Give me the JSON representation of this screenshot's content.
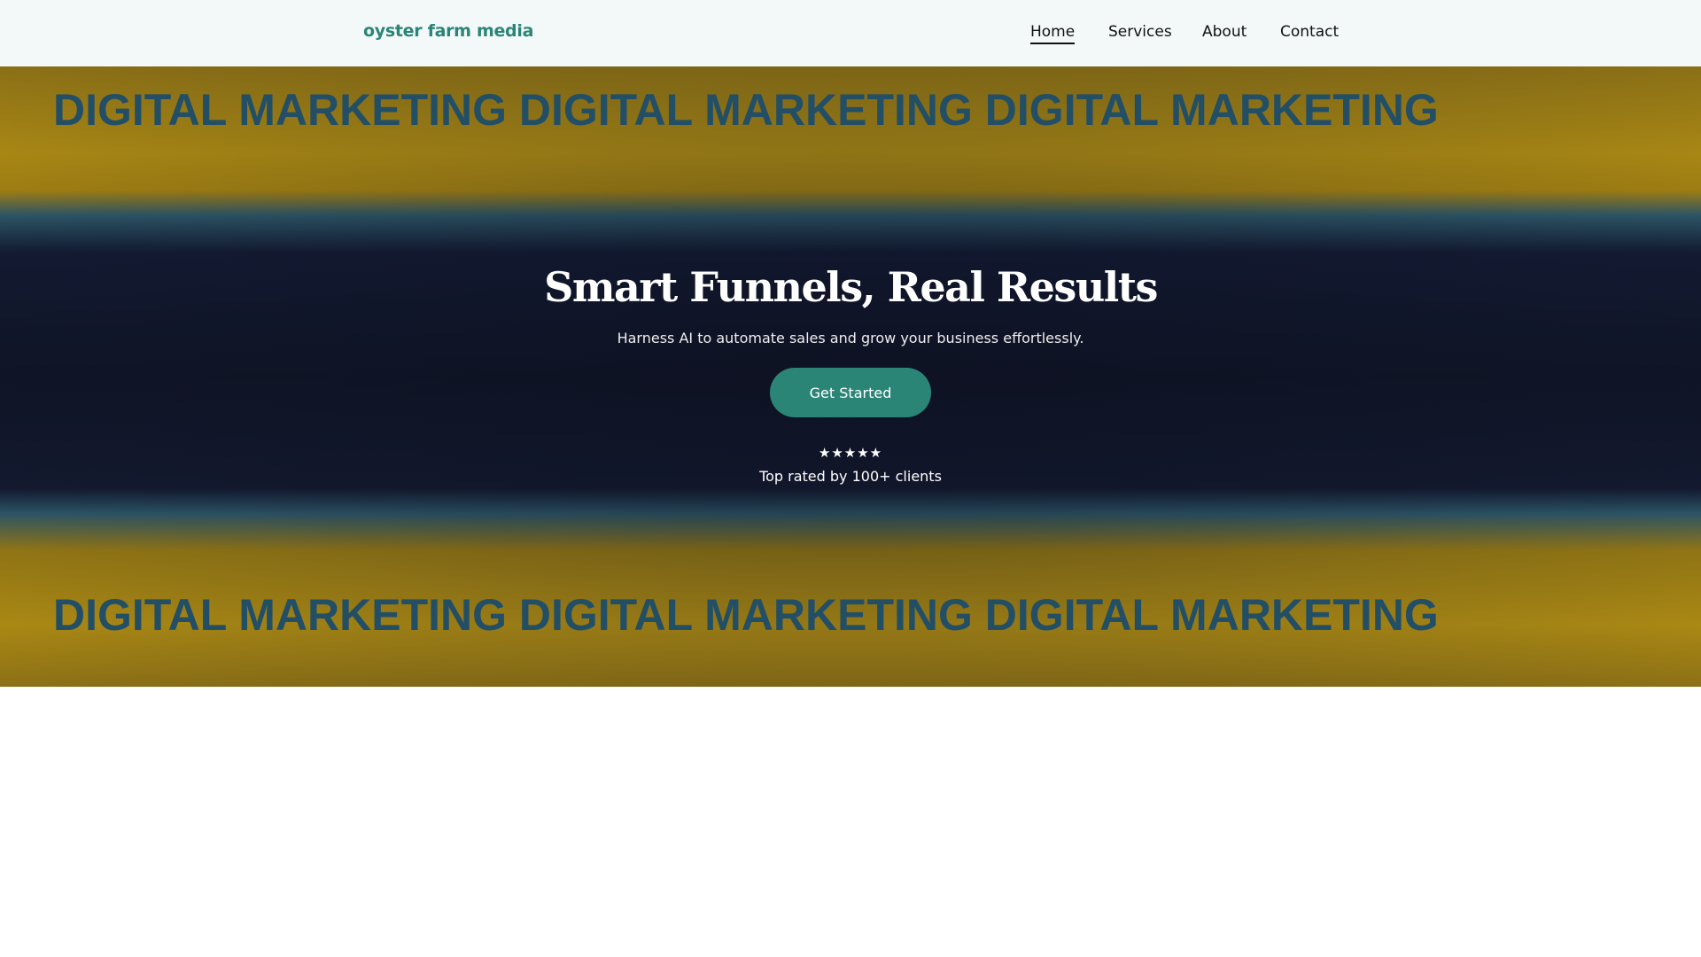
{
  "header": {
    "logo": "oyster farm media",
    "nav": [
      {
        "label": "Home",
        "active": true
      },
      {
        "label": "Services"
      },
      {
        "label": "About"
      },
      {
        "label": "Contact"
      }
    ]
  },
  "hero": {
    "title": "Smart Funnels, Real Results",
    "subtitle": "Harness AI to automate sales and grow your business effortlessly.",
    "cta": "Get Started",
    "stars": "★★★★★",
    "rating_text": "Top rated by 100+ clients",
    "background_lettering": "DIGITAL MARKETING DIGITAL MARKETING DIGITAL MARKETING"
  },
  "colors": {
    "accent": "#2a8577",
    "header_bg": "#f3f8f8"
  }
}
